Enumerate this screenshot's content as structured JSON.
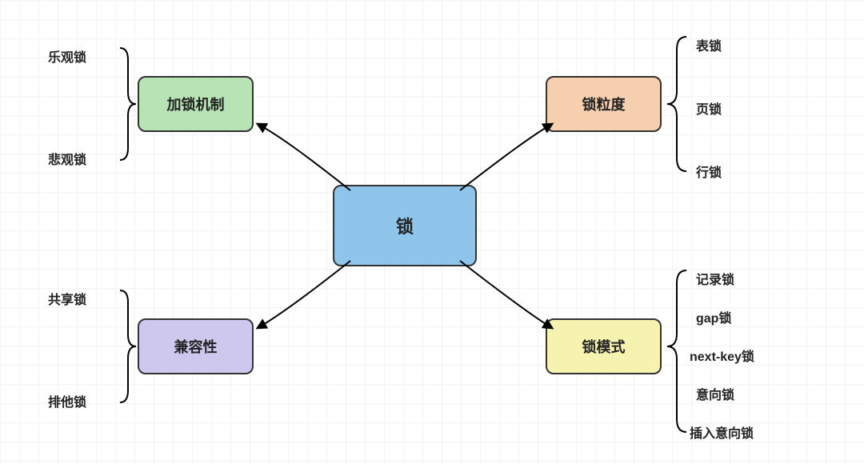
{
  "center": {
    "label": "锁"
  },
  "branches": {
    "top_left": {
      "label": "加锁机制",
      "leaves": [
        "乐观锁",
        "悲观锁"
      ]
    },
    "top_right": {
      "label": "锁粒度",
      "leaves": [
        "表锁",
        "页锁",
        "行锁"
      ]
    },
    "bottom_left": {
      "label": "兼容性",
      "leaves": [
        "共享锁",
        "排他锁"
      ]
    },
    "bottom_right": {
      "label": "锁模式",
      "leaves": [
        "记录锁",
        "gap锁",
        "next-key锁",
        "意向锁",
        "插入意向锁"
      ]
    }
  }
}
